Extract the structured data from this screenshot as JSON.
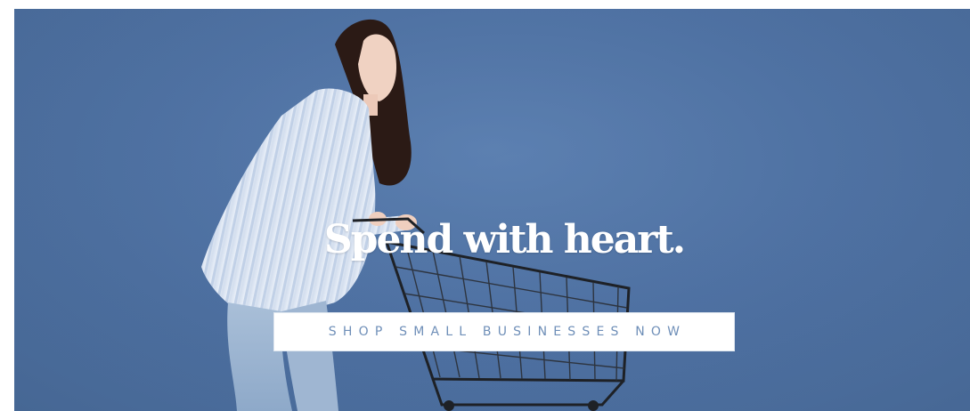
{
  "hero": {
    "headline": "Spend with heart.",
    "cta_label": "SHOP SMALL BUSINESSES NOW",
    "background_color": "#4f72a4",
    "image_subject": "woman-pushing-shopping-cart"
  }
}
